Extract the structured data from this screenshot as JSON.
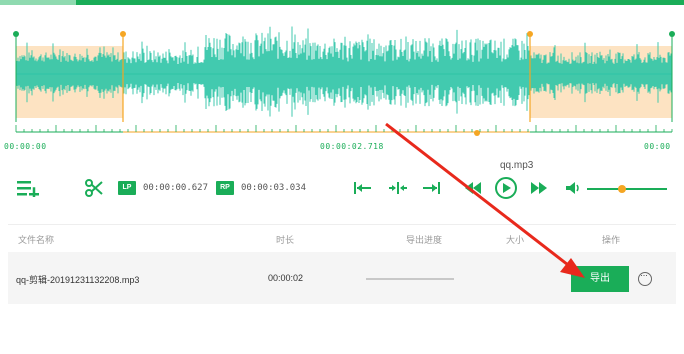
{
  "timeline": {
    "start": "00:00:00",
    "middle": "00:00:02.718",
    "end": "00:00"
  },
  "player": {
    "file_name": "qq.mp3",
    "lp_label": "LP",
    "lp_time": "00:00:00.627",
    "rp_label": "RP",
    "rp_time": "00:00:03.034",
    "volume_fraction": 0.44
  },
  "table": {
    "headers": {
      "name": "文件名称",
      "duration": "时长",
      "progress": "导出进度",
      "size": "大小",
      "action": "操作"
    },
    "rows": [
      {
        "name": "qq-剪辑-20191231132208.mp3",
        "duration": "00:00:02",
        "export_label": "导出"
      }
    ]
  },
  "colors": {
    "accent": "#1aad58",
    "wave": "#2ec4a6",
    "selection": "#fde3c2",
    "marker": "#f5a623",
    "arrow": "#e8291c"
  },
  "icons": {
    "add_list": "add-list-icon",
    "scissors": "scissors-icon",
    "go_start": "go-to-start-icon",
    "center": "center-icon",
    "go_end": "go-to-end-icon",
    "prev": "rewind-icon",
    "play": "play-icon",
    "next": "fast-forward-icon",
    "volume": "volume-icon",
    "more": "more-icon"
  }
}
